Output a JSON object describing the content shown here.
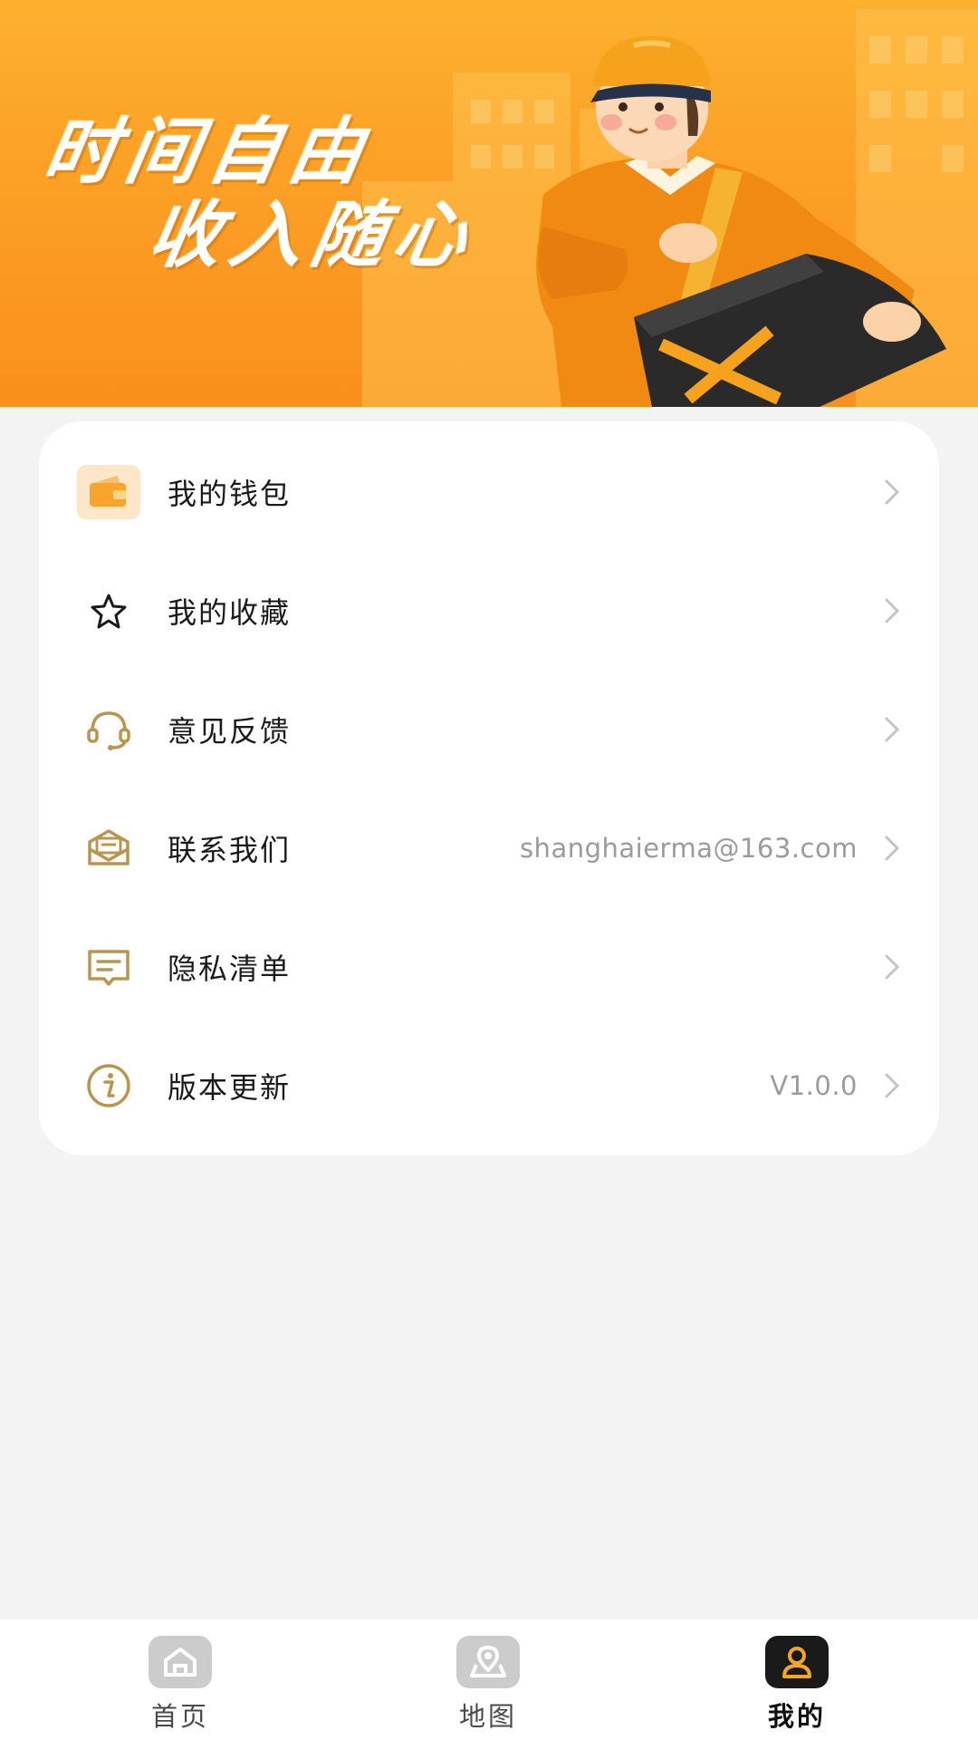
{
  "banner": {
    "line1": "时间自由",
    "line2": "收入随心"
  },
  "menu": [
    {
      "label": "我的钱包",
      "value": "",
      "icon": "wallet-icon"
    },
    {
      "label": "我的收藏",
      "value": "",
      "icon": "star-icon"
    },
    {
      "label": "意见反馈",
      "value": "",
      "icon": "headset-icon"
    },
    {
      "label": "联系我们",
      "value": "shanghaierma@163.com",
      "icon": "mail-icon"
    },
    {
      "label": "隐私清单",
      "value": "",
      "icon": "document-icon"
    },
    {
      "label": "版本更新",
      "value": "V1.0.0",
      "icon": "info-icon"
    }
  ],
  "tabs": [
    {
      "label": "首页",
      "icon": "home-icon",
      "active": false
    },
    {
      "label": "地图",
      "icon": "map-icon",
      "active": false
    },
    {
      "label": "我的",
      "icon": "profile-icon",
      "active": true
    }
  ],
  "colors": {
    "brand": "#f9a21f",
    "icon_gold": "#b8964f",
    "tab_inactive_bg": "#cccccc",
    "tab_active_bg": "#1a1a1a",
    "tab_active_icon": "#f5a623"
  }
}
